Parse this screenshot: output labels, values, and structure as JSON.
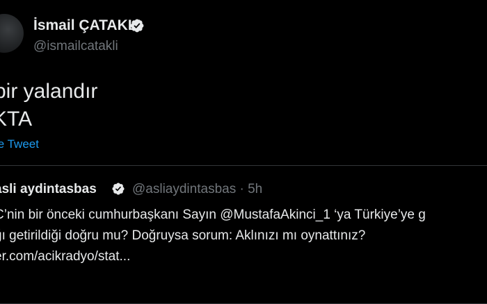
{
  "colors": {
    "background": "#000000",
    "primary_text": "#e7e9ea",
    "secondary_text": "#71767b",
    "link": "#1d9bf0",
    "border": "#333639"
  },
  "tweet": {
    "author": {
      "display_name": "İsmail ÇATAKLI",
      "handle": "@ismailcatakli",
      "verified_icon": "verified-badge-icon"
    },
    "text_lines": [
      "bir yalandır",
      "KTA"
    ],
    "translate_label": "te Tweet"
  },
  "quoted_tweet": {
    "display_name": "asli aydintasbas",
    "handle_and_time": "@asliaydintasbas · 5h",
    "verified_icon": "verified-badge-icon",
    "text_lines": [
      "C’nin bir önceki cumhurbaşkanı Sayın @MustafaAkinci_1 ‘ya Türkiye’ye g",
      "ğı getirildiği doğru mu? Doğruysa sorum: Aklınızı mı oynattınız?",
      "er.com/acikradyo/stat..."
    ]
  }
}
